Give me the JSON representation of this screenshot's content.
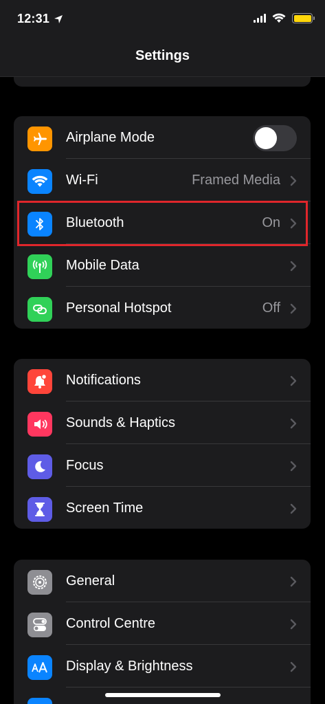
{
  "status_bar": {
    "time": "12:31"
  },
  "nav": {
    "title": "Settings"
  },
  "group1": [
    {
      "label": "Airplane Mode",
      "icon": "airplane-icon",
      "color": "#ff9500",
      "toggle": false
    },
    {
      "label": "Wi-Fi",
      "value": "Framed Media",
      "icon": "wifi-icon",
      "color": "#0a84ff"
    },
    {
      "label": "Bluetooth",
      "value": "On",
      "icon": "bluetooth-icon",
      "color": "#0a84ff"
    },
    {
      "label": "Mobile Data",
      "icon": "antenna-icon",
      "color": "#30d158"
    },
    {
      "label": "Personal Hotspot",
      "value": "Off",
      "icon": "hotspot-link-icon",
      "color": "#30d158"
    }
  ],
  "group2": [
    {
      "label": "Notifications",
      "icon": "bell-icon",
      "color": "#ff453a"
    },
    {
      "label": "Sounds & Haptics",
      "icon": "speaker-icon",
      "color": "#ff375f"
    },
    {
      "label": "Focus",
      "icon": "moon-icon",
      "color": "#5e5ce6"
    },
    {
      "label": "Screen Time",
      "icon": "hourglass-icon",
      "color": "#5e5ce6"
    }
  ],
  "group3": [
    {
      "label": "General",
      "icon": "gear-icon",
      "color": "#8e8e93"
    },
    {
      "label": "Control Centre",
      "icon": "switches-icon",
      "color": "#8e8e93"
    },
    {
      "label": "Display & Brightness",
      "icon": "text-size-icon",
      "color": "#0a84ff"
    }
  ],
  "annotation": {
    "highlight_color": "#e0262b"
  }
}
